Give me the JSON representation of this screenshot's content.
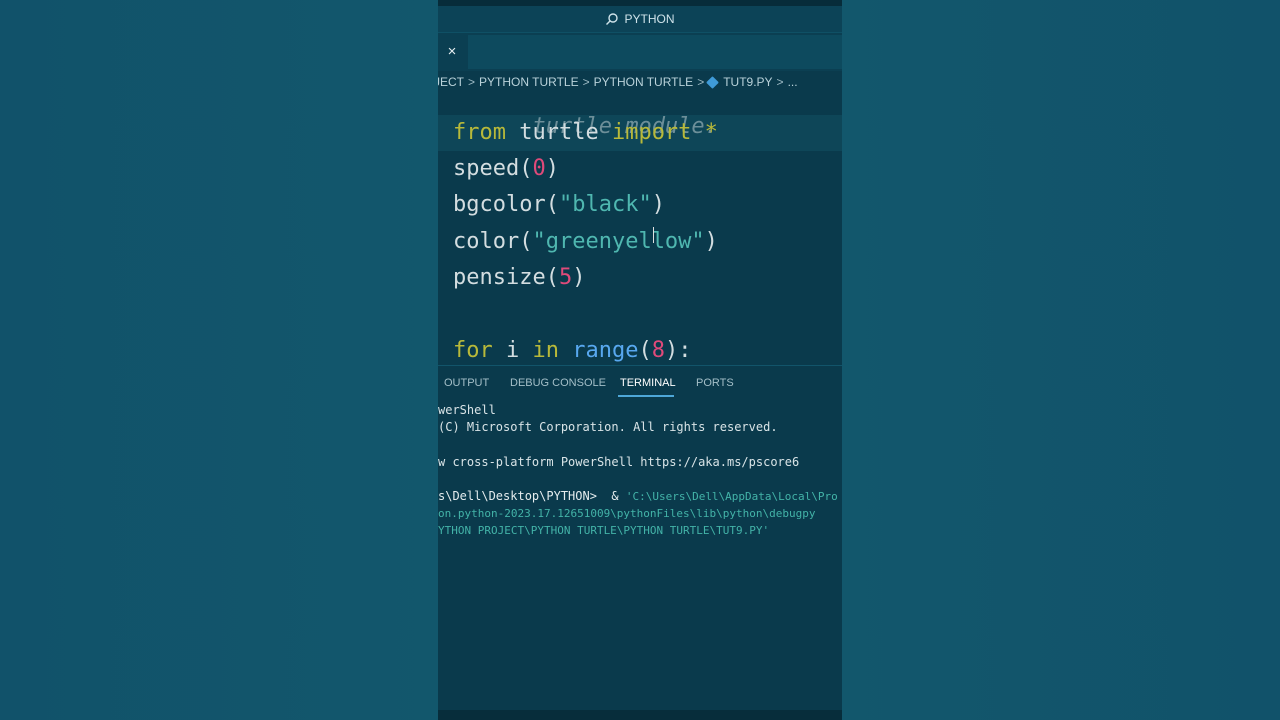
{
  "window": {
    "search_label": "PYTHON",
    "close_symbol": "×"
  },
  "breadcrumb": {
    "items": [
      "JECT",
      "PYTHON TURTLE",
      "PYTHON TURTLE",
      "TUT9.PY",
      "..."
    ],
    "separator": ">"
  },
  "editor": {
    "comment_line": "turtle module.",
    "line1": {
      "kw1": "from",
      "mod": " turtle ",
      "kw2": "import",
      "star": " *"
    },
    "line2": {
      "fn": "speed(",
      "arg": "0",
      "end": ")"
    },
    "line3": {
      "fn": "bgcolor(",
      "arg": "\"black\"",
      "end": ")"
    },
    "line4": {
      "fn": "color(",
      "arg": "\"greenyellow\"",
      "end": ")"
    },
    "line5": {
      "fn": "pensize(",
      "arg": "5",
      "end": ")"
    },
    "line7": {
      "kw1": "for",
      "var": " i ",
      "kw2": "in",
      "sp": " ",
      "builtin": "range",
      "open": "(",
      "arg": "8",
      "end": "):"
    }
  },
  "panel": {
    "tabs": [
      "OUTPUT",
      "DEBUG CONSOLE",
      "TERMINAL",
      "PORTS"
    ],
    "active_tab": "TERMINAL"
  },
  "terminal": {
    "line1": "werShell",
    "line2": "(C) Microsoft Corporation. All rights reserved.",
    "line3": "w cross-platform PowerShell https://aka.ms/pscore6",
    "prompt": "s\\Dell\\Desktop\\PYTHON>  & ",
    "cmd1": "'C:\\Users\\Dell\\AppData\\Local\\Pro",
    "cmd2": "on.python-2023.17.12651009\\pythonFiles\\lib\\python\\debugpy",
    "cmd3": "YTHON PROJECT\\PYTHON TURTLE\\PYTHON TURTLE\\TUT9.PY'"
  },
  "colors": {
    "background": "#13566b",
    "editor_bg": "#0a3a4c",
    "keyword": "#b8b93a",
    "string": "#4fb7b0",
    "number": "#e04a7a",
    "builtin": "#58a8f0"
  }
}
